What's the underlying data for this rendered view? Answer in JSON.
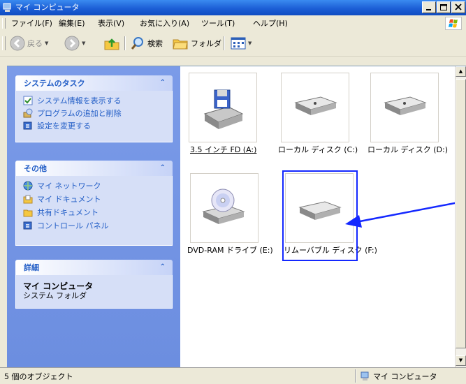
{
  "window": {
    "title": "マイ コンピュータ",
    "controls": [
      "minimize",
      "maximize",
      "close"
    ]
  },
  "menubar": {
    "items": [
      {
        "label": "ファイル(F)"
      },
      {
        "label": "編集(E)"
      },
      {
        "label": "表示(V)"
      },
      {
        "label": "お気に入り(A)"
      },
      {
        "label": "ツール(T)"
      },
      {
        "label": "ヘルプ(H)"
      }
    ]
  },
  "toolbar": {
    "back_label": "戻る",
    "search_label": "検索",
    "folders_label": "フォルダ"
  },
  "taskpane": {
    "system_tasks": {
      "title": "システムのタスク",
      "items": [
        {
          "label": "システム情報を表示する",
          "icon": "system-info-icon"
        },
        {
          "label": "プログラムの追加と削除",
          "icon": "add-remove-programs-icon"
        },
        {
          "label": "設定を変更する",
          "icon": "control-panel-icon"
        }
      ]
    },
    "other_places": {
      "title": "その他",
      "items": [
        {
          "label": "マイ ネットワーク",
          "icon": "network-icon"
        },
        {
          "label": "マイ ドキュメント",
          "icon": "my-documents-icon"
        },
        {
          "label": "共有ドキュメント",
          "icon": "shared-folder-icon"
        },
        {
          "label": "コントロール パネル",
          "icon": "control-panel-icon"
        }
      ]
    },
    "details": {
      "title": "詳細",
      "name": "マイ コンピュータ",
      "type": "システム フォルダ"
    }
  },
  "drives": [
    {
      "label": "3.5 インチ FD (A:)",
      "icon": "floppy-drive-icon"
    },
    {
      "label": "ローカル ディスク (C:)",
      "icon": "hard-disk-icon"
    },
    {
      "label": "ローカル ディスク (D:)",
      "icon": "hard-disk-icon"
    },
    {
      "label": "DVD-RAM ドライブ (E:)",
      "icon": "dvd-drive-icon"
    },
    {
      "label": "リムーバブル ディスク (F:)",
      "icon": "removable-disk-icon"
    }
  ],
  "statusbar": {
    "object_count": "5 個のオブジェクト",
    "location": "マイ コンピュータ"
  },
  "colors": {
    "titlebar": "#1c5fd6",
    "taskpane_bg": "#7b9be8",
    "taskpane_link": "#215dc6",
    "highlight_box": "#1428ff",
    "arrow": "#1428ff"
  }
}
